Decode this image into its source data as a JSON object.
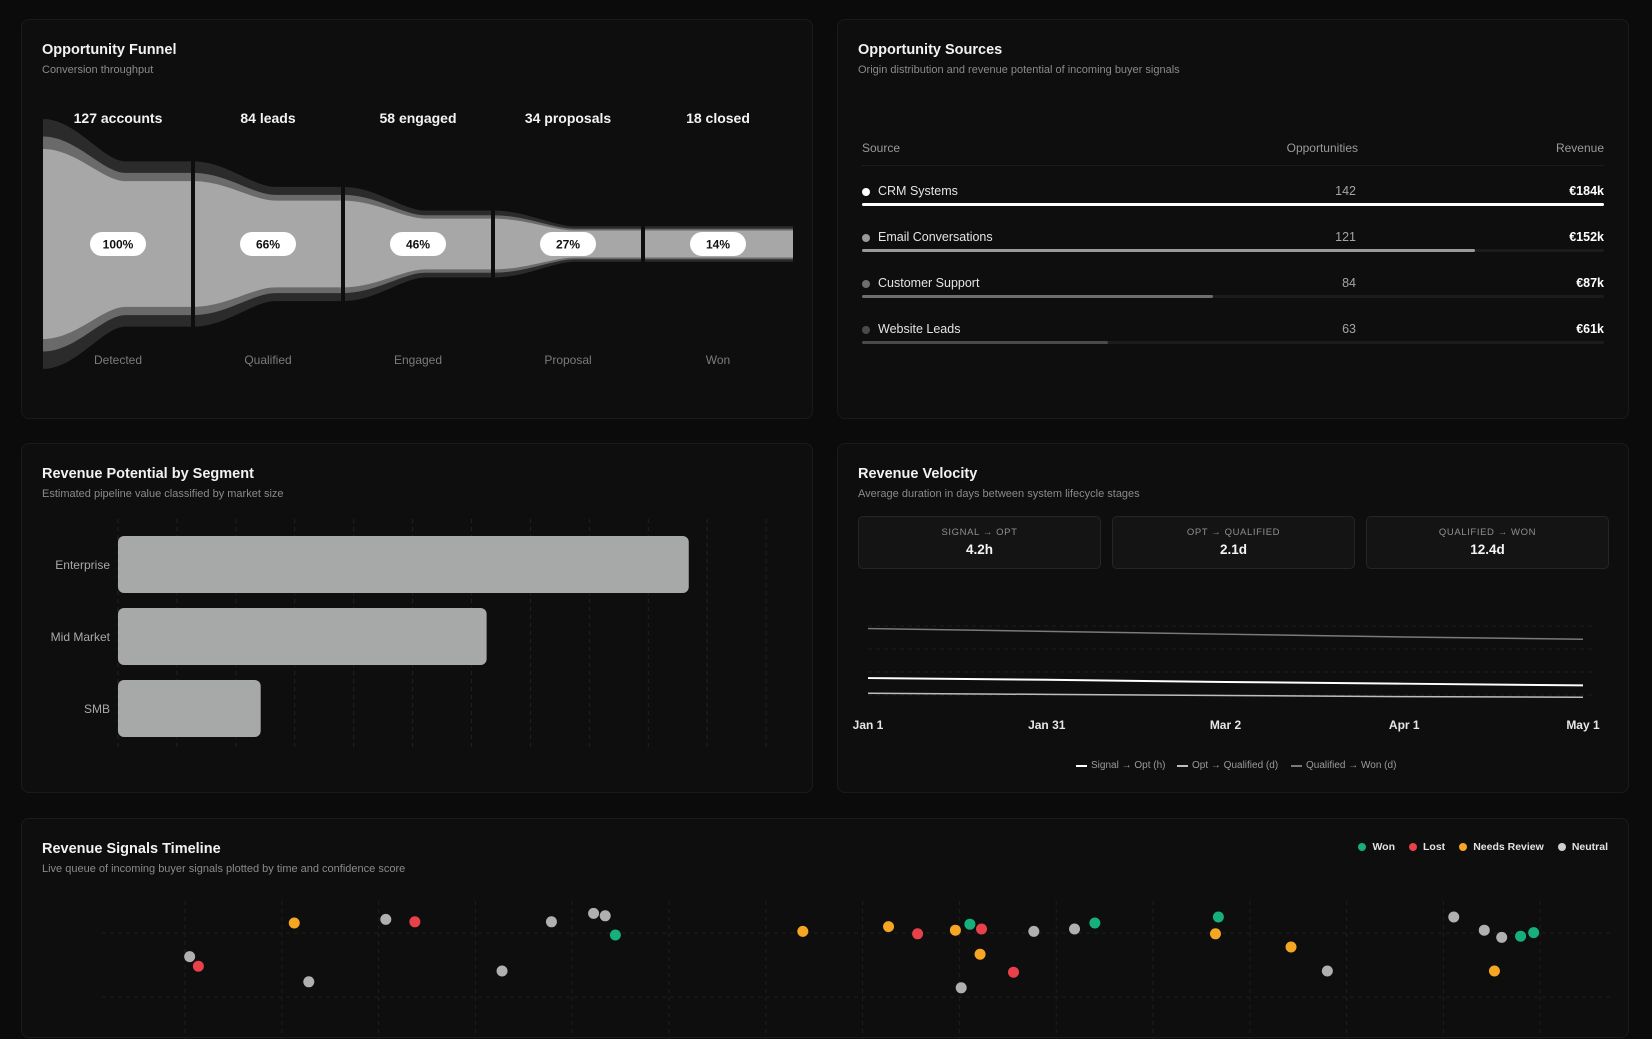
{
  "funnel": {
    "title": "Opportunity Funnel",
    "subtitle": "Conversion throughput",
    "stages": [
      {
        "count": "127 accounts",
        "pct": "100%",
        "label": "Detected",
        "value": 127
      },
      {
        "count": "84 leads",
        "pct": "66%",
        "label": "Qualified",
        "value": 84
      },
      {
        "count": "58 engaged",
        "pct": "46%",
        "label": "Engaged",
        "value": 58
      },
      {
        "count": "34 proposals",
        "pct": "27%",
        "label": "Proposal",
        "value": 34
      },
      {
        "count": "18 closed",
        "pct": "14%",
        "label": "Won",
        "value": 18
      }
    ]
  },
  "sources": {
    "title": "Opportunity Sources",
    "subtitle": "Origin distribution and revenue potential of incoming buyer signals",
    "headers": {
      "source": "Source",
      "opportunities": "Opportunities",
      "revenue": "Revenue"
    },
    "rows": [
      {
        "name": "CRM Systems",
        "opportunities": "142",
        "revenue": "€184k",
        "share": 1.0,
        "color": "#ffffff"
      },
      {
        "name": "Email Conversations",
        "opportunities": "121",
        "revenue": "€152k",
        "share": 0.826,
        "color": "#9a9a9a"
      },
      {
        "name": "Customer Support",
        "opportunities": "84",
        "revenue": "€87k",
        "share": 0.473,
        "color": "#6e6e6e"
      },
      {
        "name": "Website Leads",
        "opportunities": "63",
        "revenue": "€61k",
        "share": 0.331,
        "color": "#4a4a4a"
      }
    ]
  },
  "segments": {
    "title": "Revenue Potential by Segment",
    "subtitle": "Estimated pipeline value classified by market size",
    "chart_data": {
      "type": "bar",
      "orientation": "horizontal",
      "categories": [
        "Enterprise",
        "Mid Market",
        "SMB"
      ],
      "values": [
        96,
        62,
        24
      ],
      "xlim": [
        0,
        110
      ],
      "grid": "vertical dashed",
      "color": "#a7a9a8"
    }
  },
  "velocity": {
    "title": "Revenue Velocity",
    "subtitle": "Average duration in days between system lifecycle stages",
    "stats": [
      {
        "label": "SIGNAL → OPT",
        "value": "4.2h"
      },
      {
        "label": "OPT → QUALIFIED",
        "value": "2.1d"
      },
      {
        "label": "QUALIFIED → WON",
        "value": "12.4d"
      }
    ],
    "legend": [
      "Signal → Opt (h)",
      "Opt → Qualified (d)",
      "Qualified → Won (d)"
    ],
    "chart_data": {
      "type": "line",
      "x": [
        "Jan 1",
        "Jan 31",
        "Mar 2",
        "Apr 1",
        "May 1"
      ],
      "ylim": [
        0,
        16
      ],
      "series": [
        {
          "name": "Signal → Opt (h)",
          "values": [
            5.5,
            5.2,
            4.8,
            4.5,
            4.2
          ],
          "color": "#ffffff"
        },
        {
          "name": "Opt → Qualified (d)",
          "values": [
            2.8,
            2.6,
            2.4,
            2.2,
            2.1
          ],
          "color": "#bdbdbd"
        },
        {
          "name": "Qualified → Won (d)",
          "values": [
            14.3,
            13.8,
            13.3,
            12.8,
            12.4
          ],
          "color": "#7a7a7a"
        }
      ]
    }
  },
  "timeline": {
    "title": "Revenue Signals Timeline",
    "subtitle": "Live queue of incoming buyer signals plotted by time and confidence score",
    "legend": [
      {
        "label": "Won",
        "color": "#16b07c"
      },
      {
        "label": "Lost",
        "color": "#e8414a"
      },
      {
        "label": "Needs Review",
        "color": "#f5a623"
      },
      {
        "label": "Neutral",
        "color": "#cfcfcf"
      }
    ],
    "chart_data": {
      "type": "scatter",
      "xlim": [
        0,
        100
      ],
      "ylim": [
        0,
        100
      ],
      "points": [
        {
          "x": 5,
          "y": 52,
          "status": "Neutral"
        },
        {
          "x": 5.6,
          "y": 44,
          "status": "Lost"
        },
        {
          "x": 12.2,
          "y": 80,
          "status": "Needs Review"
        },
        {
          "x": 13.2,
          "y": 31,
          "status": "Neutral"
        },
        {
          "x": 18.5,
          "y": 83,
          "status": "Neutral"
        },
        {
          "x": 20.5,
          "y": 81,
          "status": "Lost"
        },
        {
          "x": 26.5,
          "y": 40,
          "status": "Neutral"
        },
        {
          "x": 29.9,
          "y": 81,
          "status": "Neutral"
        },
        {
          "x": 32.8,
          "y": 88,
          "status": "Neutral"
        },
        {
          "x": 33.6,
          "y": 86,
          "status": "Neutral"
        },
        {
          "x": 34.3,
          "y": 70,
          "status": "Won"
        },
        {
          "x": 47.2,
          "y": 73,
          "status": "Needs Review"
        },
        {
          "x": 53.1,
          "y": 77,
          "status": "Needs Review"
        },
        {
          "x": 55.1,
          "y": 71,
          "status": "Lost"
        },
        {
          "x": 57.7,
          "y": 74,
          "status": "Needs Review"
        },
        {
          "x": 58.7,
          "y": 79,
          "status": "Won"
        },
        {
          "x": 59.5,
          "y": 75,
          "status": "Lost"
        },
        {
          "x": 59.4,
          "y": 54,
          "status": "Needs Review"
        },
        {
          "x": 58.1,
          "y": 26,
          "status": "Neutral"
        },
        {
          "x": 61.7,
          "y": 39,
          "status": "Lost"
        },
        {
          "x": 63.1,
          "y": 73,
          "status": "Neutral"
        },
        {
          "x": 65.9,
          "y": 75,
          "status": "Neutral"
        },
        {
          "x": 67.3,
          "y": 80,
          "status": "Won"
        },
        {
          "x": 75.6,
          "y": 71,
          "status": "Needs Review"
        },
        {
          "x": 75.8,
          "y": 85,
          "status": "Won"
        },
        {
          "x": 80.8,
          "y": 60,
          "status": "Needs Review"
        },
        {
          "x": 83.3,
          "y": 40,
          "status": "Neutral"
        },
        {
          "x": 92.0,
          "y": 85,
          "status": "Neutral"
        },
        {
          "x": 94.1,
          "y": 74,
          "status": "Neutral"
        },
        {
          "x": 94.8,
          "y": 40,
          "status": "Needs Review"
        },
        {
          "x": 95.3,
          "y": 68,
          "status": "Neutral"
        },
        {
          "x": 96.6,
          "y": 69,
          "status": "Won"
        },
        {
          "x": 97.5,
          "y": 72,
          "status": "Won"
        }
      ]
    }
  }
}
